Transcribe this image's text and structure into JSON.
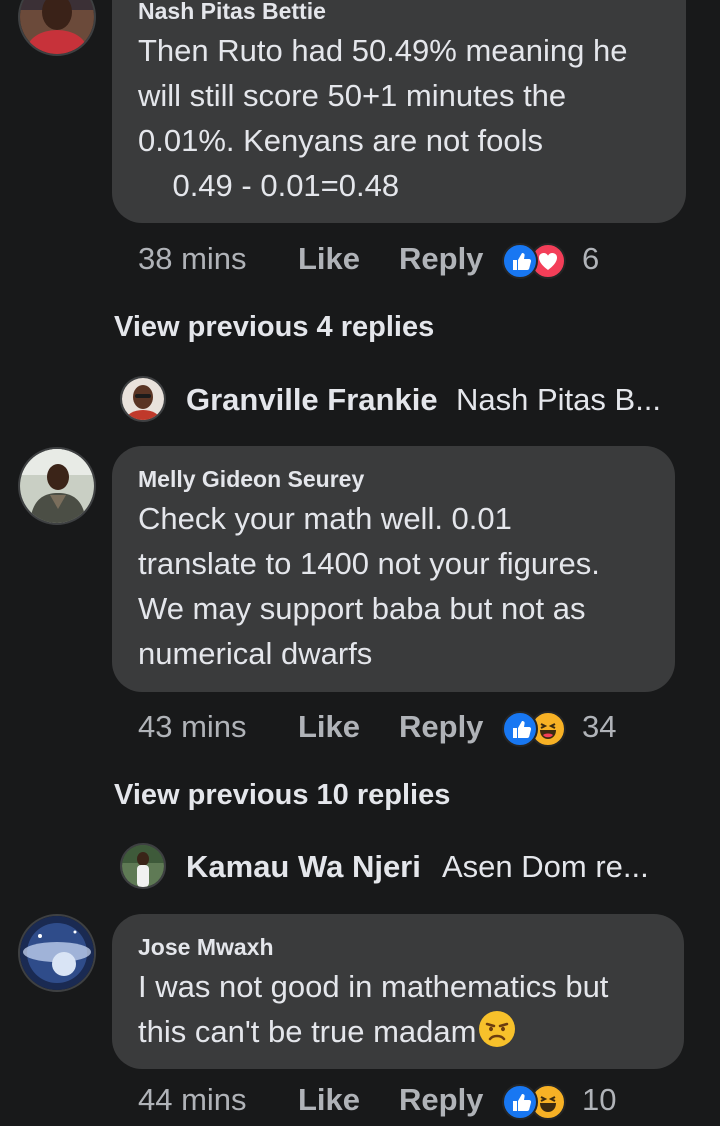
{
  "comments": [
    {
      "author": "Nash Pitas Bettie",
      "lines": [
        "Then Ruto had 50.49% meaning he",
        "will still score 50+1 minutes the",
        "0.01%. Kenyans are not fools",
        "    0.49 - 0.01=0.48"
      ],
      "time": "38 mins",
      "like_label": "Like",
      "reply_label": "Reply",
      "reactions": [
        "like-reaction",
        "love-reaction"
      ],
      "reaction_count": "6"
    },
    {
      "author": "Melly Gideon Seurey",
      "lines": [
        "Check your math well. 0.01",
        "translate to 1400 not your figures.",
        "We may support baba but not as",
        "numerical dwarfs"
      ],
      "time": "43 mins",
      "like_label": "Like",
      "reply_label": "Reply",
      "reactions": [
        "like-reaction",
        "haha-reaction"
      ],
      "reaction_count": "34"
    },
    {
      "author": "Jose Mwaxh",
      "lines": [
        "I was not good in mathematics but",
        "this can't be true madam"
      ],
      "emoji": "disappointed-emoji",
      "time": "44 mins",
      "like_label": "Like",
      "reply_label": "Reply",
      "reactions": [
        "like-reaction",
        "haha-reaction"
      ],
      "reaction_count": "10"
    }
  ],
  "threads": [
    {
      "view_previous": "View previous 4 replies",
      "latest_reply_author": "Granville Frankie",
      "latest_reply_preview": "Nash Pitas B..."
    },
    {
      "view_previous": "View previous 10 replies",
      "latest_reply_author": "Kamau Wa Njeri",
      "latest_reply_preview": "Asen Dom re..."
    }
  ],
  "colors": {
    "background": "#18191a",
    "bubble": "#3a3b3c",
    "text_primary": "#e4e6eb",
    "text_secondary": "#b0b3b8",
    "like_blue": "#1877f2",
    "love_red": "#f33e58",
    "haha_yellow": "#f7b125"
  }
}
